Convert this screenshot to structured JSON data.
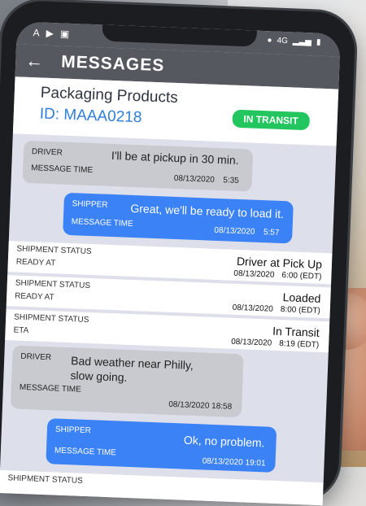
{
  "status_bar": {
    "network": "4G",
    "left_icons": [
      "A",
      "▶",
      "▣"
    ]
  },
  "app": {
    "title": "MESSAGES"
  },
  "shipment": {
    "name": "Packaging Products",
    "id": "ID: MAAA0218",
    "status": "IN TRANSIT"
  },
  "messages": [
    {
      "role": "DRIVER",
      "time_label": "MESSAGE TIME",
      "text": "I'll be at pickup in 30 min.",
      "date": "08/13/2020",
      "time": "5:35"
    },
    {
      "role": "SHIPPER",
      "time_label": "MESSAGE TIME",
      "text": "Great, we'll be ready to load it.",
      "date": "08/13/2020",
      "time": "5:57"
    },
    {
      "role": "DRIVER",
      "time_label": "MESSAGE TIME",
      "text_line1": "Bad weather near Philly,",
      "text_line2": "slow going.",
      "date": "08/13/2020 18:58"
    },
    {
      "role": "SHIPPER",
      "time_label": "MESSAGE TIME",
      "text": "Ok, no problem.",
      "date": "08/13/2020 19:01"
    }
  ],
  "statuses": [
    {
      "label": "SHIPMENT STATUS",
      "sub": "READY AT",
      "value": "Driver at Pick Up",
      "date": "08/13/2020",
      "time": "6:00 (EDT)"
    },
    {
      "label": "SHIPMENT STATUS",
      "sub": "READY AT",
      "value": "Loaded",
      "date": "08/13/2020",
      "time": "8:00 (EDT)"
    },
    {
      "label": "SHIPMENT STATUS",
      "sub": "ETA",
      "value": "In Transit",
      "date": "08/13/2020",
      "time": "8:19 (EDT)"
    },
    {
      "label": "SHIPMENT STATUS"
    }
  ]
}
